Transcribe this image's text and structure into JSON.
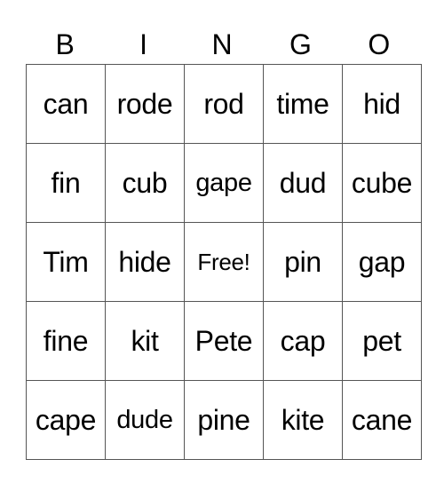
{
  "header": [
    "B",
    "I",
    "N",
    "G",
    "O"
  ],
  "rows": [
    [
      "can",
      "rode",
      "rod",
      "time",
      "hid"
    ],
    [
      "fin",
      "cub",
      "gape",
      "dud",
      "cube"
    ],
    [
      "Tim",
      "hide",
      "Free!",
      "pin",
      "gap"
    ],
    [
      "fine",
      "kit",
      "Pete",
      "cap",
      "pet"
    ],
    [
      "cape",
      "dude",
      "pine",
      "kite",
      "cane"
    ]
  ]
}
